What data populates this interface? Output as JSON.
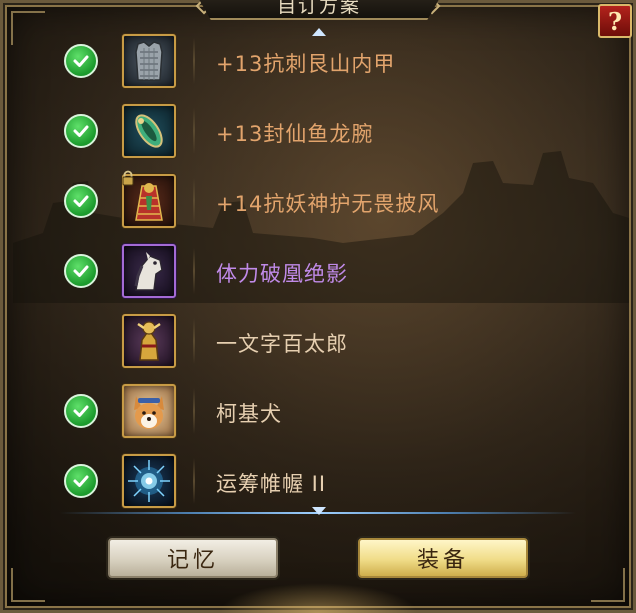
{
  "window": {
    "title": "自订方案",
    "help_label": "?"
  },
  "equipment": [
    {
      "name": "+13抗刺艮山内甲",
      "checked": true,
      "locked": false,
      "rarity_color": "#e2a46c",
      "icon": "armor-vest-icon"
    },
    {
      "name": "+13封仙鱼龙腕",
      "checked": true,
      "locked": false,
      "rarity_color": "#e2a46c",
      "icon": "bracer-icon"
    },
    {
      "name": "+14抗妖神护无畏披风",
      "checked": true,
      "locked": true,
      "rarity_color": "#e2a46c",
      "icon": "cloak-icon"
    },
    {
      "name": "体力破凰绝影",
      "checked": true,
      "locked": false,
      "rarity_color": "#c08ae8",
      "icon": "horse-icon"
    },
    {
      "name": "一文字百太郎",
      "checked": false,
      "locked": false,
      "rarity_color": "#e6cfb0",
      "icon": "warrior-statue-icon"
    },
    {
      "name": "柯基犬",
      "checked": true,
      "locked": false,
      "rarity_color": "#e6cfb0",
      "icon": "corgi-icon"
    },
    {
      "name": "运筹帷幄 II",
      "checked": true,
      "locked": false,
      "rarity_color": "#e6cfb0",
      "icon": "blue-burst-icon"
    }
  ],
  "buttons": {
    "memory_label": "记忆",
    "equip_label": "装备"
  }
}
